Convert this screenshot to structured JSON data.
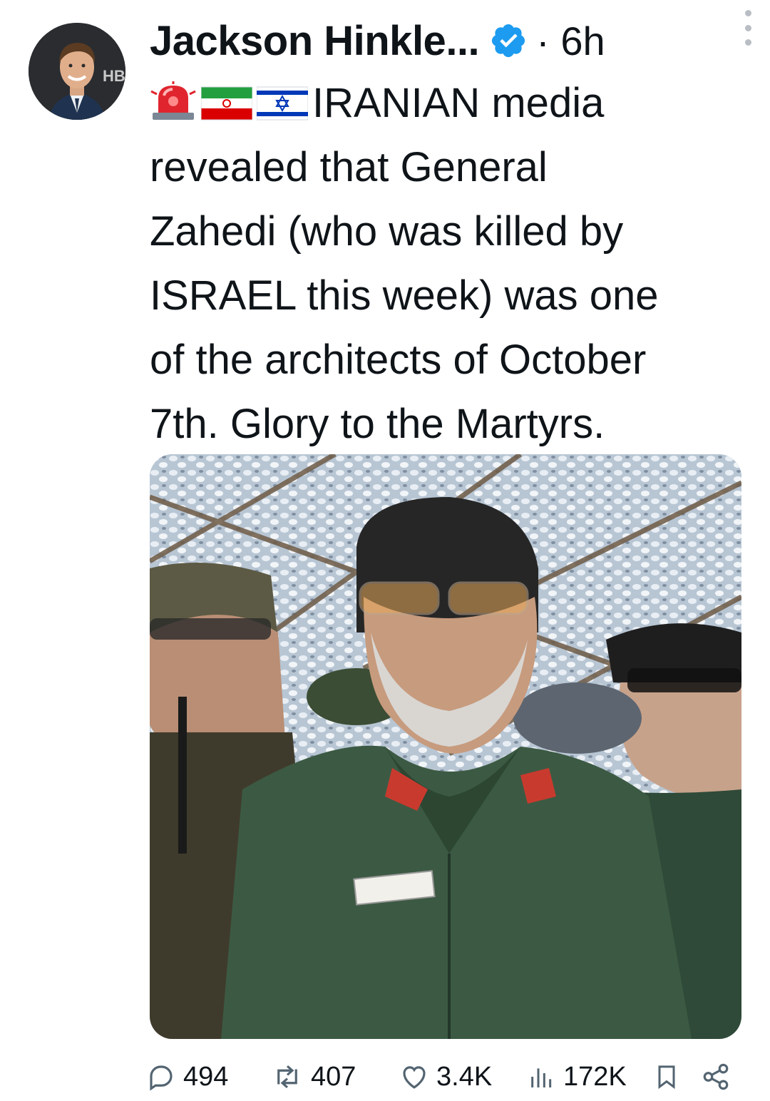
{
  "author": {
    "name": "Jackson Hinkle...",
    "verified": true,
    "time": "· 6h"
  },
  "tweet": {
    "text_lines": [
      "IRANIAN media",
      "revealed that General",
      "Zahedi (who was killed by",
      "ISRAEL this week) was one",
      "of the architects of October",
      "7th. Glory to the Martyrs."
    ],
    "leading_emojis": [
      "police-light-emoji",
      "iran-flag-emoji",
      "israel-flag-emoji"
    ]
  },
  "actions": {
    "replies": "494",
    "reposts": "407",
    "likes": "3.4K",
    "views": "172K"
  },
  "colors": {
    "verified": "#1d9bf0",
    "icon_gray": "#536471",
    "text": "#0f1419"
  }
}
